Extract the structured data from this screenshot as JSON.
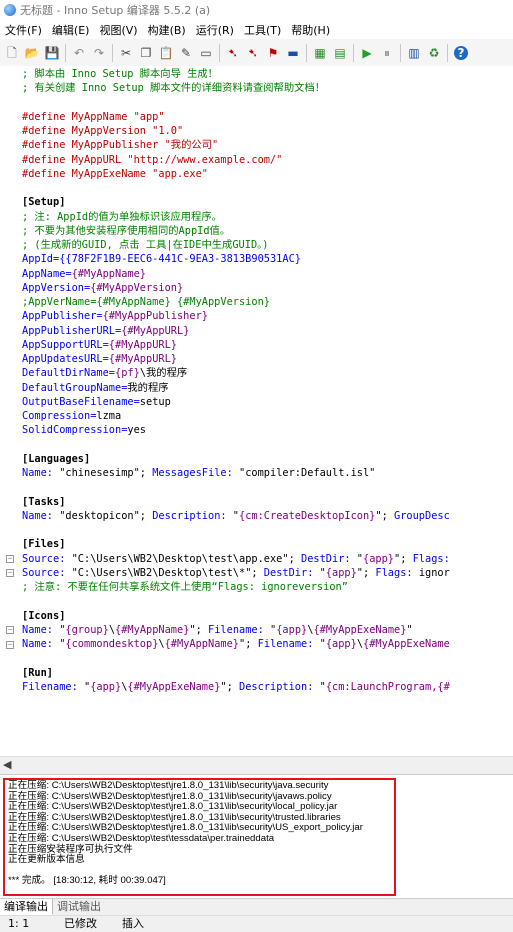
{
  "window": {
    "title": "无标题 - Inno Setup 编译器 5.5.2 (a)"
  },
  "menu": [
    "文件(F)",
    "编辑(E)",
    "视图(V)",
    "构建(B)",
    "运行(R)",
    "工具(T)",
    "帮助(H)"
  ],
  "toolbar": [
    {
      "name": "new-file-icon",
      "glyph": "🗋",
      "color": "#555"
    },
    {
      "name": "open-folder-icon",
      "glyph": "📂",
      "color": "#c9a000"
    },
    {
      "name": "save-icon",
      "glyph": "💾",
      "color": "#1b4fa8"
    },
    {
      "sep": true
    },
    {
      "name": "undo-icon",
      "glyph": "↶",
      "color": "#888"
    },
    {
      "name": "redo-icon",
      "glyph": "↷",
      "color": "#888"
    },
    {
      "sep": true
    },
    {
      "name": "cut-icon",
      "glyph": "✂",
      "color": "#444"
    },
    {
      "name": "copy-icon",
      "glyph": "❐",
      "color": "#444"
    },
    {
      "name": "paste-icon",
      "glyph": "📋",
      "color": "#444"
    },
    {
      "name": "edit-icon",
      "glyph": "✎",
      "color": "#444"
    },
    {
      "name": "file-icon",
      "glyph": "▭",
      "color": "#444"
    },
    {
      "sep": true
    },
    {
      "name": "compile-icon",
      "glyph": "➷",
      "color": "#c00000"
    },
    {
      "name": "compile-selection-icon",
      "glyph": "➷",
      "color": "#c00000"
    },
    {
      "name": "find-icon",
      "glyph": "⚑",
      "color": "#c00000"
    },
    {
      "name": "replace-icon",
      "glyph": "▬",
      "color": "#1b4fa8"
    },
    {
      "sep": true
    },
    {
      "name": "build-icon",
      "glyph": "▦",
      "color": "#2a8a2a"
    },
    {
      "name": "stop-build-icon",
      "glyph": "▤",
      "color": "#2a8a2a"
    },
    {
      "sep": true
    },
    {
      "name": "run-icon",
      "glyph": "▶",
      "color": "#22a022"
    },
    {
      "name": "pause-icon",
      "glyph": "⏸",
      "color": "#888"
    },
    {
      "sep": true
    },
    {
      "name": "wizard-icon",
      "glyph": "▥",
      "color": "#1b4fa8"
    },
    {
      "name": "settings-icon",
      "glyph": "♻",
      "color": "#2a8a2a"
    },
    {
      "sep": true
    },
    {
      "name": "help-icon",
      "glyph": "?",
      "color": "#fff",
      "bg": "#1b6ac9"
    }
  ],
  "editor": {
    "lines": [
      {
        "fold": false,
        "t": [
          [
            "com",
            "; 脚本由 Inno Setup 脚本向导 生成！"
          ]
        ]
      },
      {
        "fold": false,
        "t": [
          [
            "com",
            "; 有关创建 Inno Setup 脚本文件的详细资料请查阅帮助文档！"
          ]
        ]
      },
      {
        "fold": false,
        "t": []
      },
      {
        "fold": false,
        "t": [
          [
            "dir",
            "#define MyAppName \"app\""
          ]
        ]
      },
      {
        "fold": false,
        "t": [
          [
            "dir",
            "#define MyAppVersion \"1.0\""
          ]
        ]
      },
      {
        "fold": false,
        "t": [
          [
            "dir",
            "#define MyAppPublisher \"我的公司\""
          ]
        ]
      },
      {
        "fold": false,
        "t": [
          [
            "dir",
            "#define MyAppURL \"http://www.example.com/\""
          ]
        ]
      },
      {
        "fold": false,
        "t": [
          [
            "dir",
            "#define MyAppExeName \"app.exe\""
          ]
        ]
      },
      {
        "fold": false,
        "t": []
      },
      {
        "fold": false,
        "t": [
          [
            "sec",
            "[Setup]"
          ]
        ]
      },
      {
        "fold": false,
        "t": [
          [
            "com",
            "; 注: AppId的值为单独标识该应用程序。"
          ]
        ]
      },
      {
        "fold": false,
        "t": [
          [
            "com",
            "; 不要为其他安装程序使用相同的AppId值。"
          ]
        ]
      },
      {
        "fold": false,
        "t": [
          [
            "com",
            "; (生成新的GUID, 点击 工具|在IDE中生成GUID。)"
          ]
        ]
      },
      {
        "fold": false,
        "t": [
          [
            "key",
            "AppId={{78F2F1B9-EEC6-441C-9EA3-3813B90531AC}"
          ]
        ]
      },
      {
        "fold": false,
        "t": [
          [
            "key",
            "AppName="
          ],
          [
            "const",
            "{#MyAppName}"
          ]
        ]
      },
      {
        "fold": false,
        "t": [
          [
            "key",
            "AppVersion="
          ],
          [
            "const",
            "{#MyAppVersion}"
          ]
        ]
      },
      {
        "fold": false,
        "t": [
          [
            "com",
            ";AppVerName={#MyAppName} {#MyAppVersion}"
          ]
        ]
      },
      {
        "fold": false,
        "t": [
          [
            "key",
            "AppPublisher="
          ],
          [
            "const",
            "{#MyAppPublisher}"
          ]
        ]
      },
      {
        "fold": false,
        "t": [
          [
            "key",
            "AppPublisherURL="
          ],
          [
            "const",
            "{#MyAppURL}"
          ]
        ]
      },
      {
        "fold": false,
        "t": [
          [
            "key",
            "AppSupportURL="
          ],
          [
            "const",
            "{#MyAppURL}"
          ]
        ]
      },
      {
        "fold": false,
        "t": [
          [
            "key",
            "AppUpdatesURL="
          ],
          [
            "const",
            "{#MyAppURL}"
          ]
        ]
      },
      {
        "fold": false,
        "t": [
          [
            "key",
            "DefaultDirName="
          ],
          [
            "const",
            "{pf}"
          ],
          [
            "plain",
            "\\我的程序"
          ]
        ]
      },
      {
        "fold": false,
        "t": [
          [
            "key",
            "DefaultGroupName="
          ],
          [
            "plain",
            "我的程序"
          ]
        ]
      },
      {
        "fold": false,
        "t": [
          [
            "key",
            "OutputBaseFilename="
          ],
          [
            "plain",
            "setup"
          ]
        ]
      },
      {
        "fold": false,
        "t": [
          [
            "key",
            "Compression="
          ],
          [
            "plain",
            "lzma"
          ]
        ]
      },
      {
        "fold": false,
        "t": [
          [
            "key",
            "SolidCompression="
          ],
          [
            "plain",
            "yes"
          ]
        ]
      },
      {
        "fold": false,
        "t": []
      },
      {
        "fold": false,
        "t": [
          [
            "sec",
            "[Languages]"
          ]
        ]
      },
      {
        "fold": false,
        "t": [
          [
            "key",
            "Name: "
          ],
          [
            "str",
            "\"chinesesimp\""
          ],
          [
            "plain",
            "; "
          ],
          [
            "key",
            "MessagesFile: "
          ],
          [
            "str",
            "\"compiler:Default.isl\""
          ]
        ]
      },
      {
        "fold": false,
        "t": []
      },
      {
        "fold": false,
        "t": [
          [
            "sec",
            "[Tasks]"
          ]
        ]
      },
      {
        "fold": false,
        "t": [
          [
            "key",
            "Name: "
          ],
          [
            "str",
            "\"desktopicon\""
          ],
          [
            "plain",
            "; "
          ],
          [
            "key",
            "Description: "
          ],
          [
            "str",
            "\""
          ],
          [
            "const",
            "{cm:CreateDesktopIcon}"
          ],
          [
            "str",
            "\""
          ],
          [
            "plain",
            "; "
          ],
          [
            "key",
            "GroupDesc"
          ]
        ]
      },
      {
        "fold": false,
        "t": []
      },
      {
        "fold": false,
        "t": [
          [
            "sec",
            "[Files]"
          ]
        ]
      },
      {
        "fold": true,
        "t": [
          [
            "key",
            "Source: "
          ],
          [
            "str",
            "\"C:\\Users\\WB2\\Desktop\\test\\app.exe\""
          ],
          [
            "plain",
            "; "
          ],
          [
            "key",
            "DestDir: "
          ],
          [
            "str",
            "\""
          ],
          [
            "const",
            "{app}"
          ],
          [
            "str",
            "\""
          ],
          [
            "plain",
            "; "
          ],
          [
            "key",
            "Flags:"
          ]
        ]
      },
      {
        "fold": true,
        "t": [
          [
            "key",
            "Source: "
          ],
          [
            "str",
            "\"C:\\Users\\WB2\\Desktop\\test\\*\""
          ],
          [
            "plain",
            "; "
          ],
          [
            "key",
            "DestDir: "
          ],
          [
            "str",
            "\""
          ],
          [
            "const",
            "{app}"
          ],
          [
            "str",
            "\""
          ],
          [
            "plain",
            "; "
          ],
          [
            "key",
            "Flags: "
          ],
          [
            "plain",
            "ignor"
          ]
        ]
      },
      {
        "fold": false,
        "t": [
          [
            "com",
            "; 注意: 不要在任何共享系统文件上使用“Flags: ignoreversion”"
          ]
        ]
      },
      {
        "fold": false,
        "t": []
      },
      {
        "fold": false,
        "t": [
          [
            "sec",
            "[Icons]"
          ]
        ]
      },
      {
        "fold": true,
        "t": [
          [
            "key",
            "Name: "
          ],
          [
            "str",
            "\""
          ],
          [
            "const",
            "{group}"
          ],
          [
            "str",
            "\\"
          ],
          [
            "const",
            "{#MyAppName}"
          ],
          [
            "str",
            "\""
          ],
          [
            "plain",
            "; "
          ],
          [
            "key",
            "Filename: "
          ],
          [
            "str",
            "\""
          ],
          [
            "const",
            "{app}"
          ],
          [
            "str",
            "\\"
          ],
          [
            "const",
            "{#MyAppExeName}"
          ],
          [
            "str",
            "\""
          ]
        ]
      },
      {
        "fold": true,
        "t": [
          [
            "key",
            "Name: "
          ],
          [
            "str",
            "\""
          ],
          [
            "const",
            "{commondesktop}"
          ],
          [
            "str",
            "\\"
          ],
          [
            "const",
            "{#MyAppName}"
          ],
          [
            "str",
            "\""
          ],
          [
            "plain",
            "; "
          ],
          [
            "key",
            "Filename: "
          ],
          [
            "str",
            "\""
          ],
          [
            "const",
            "{app}"
          ],
          [
            "str",
            "\\"
          ],
          [
            "const",
            "{#MyAppExeName"
          ]
        ]
      },
      {
        "fold": false,
        "t": []
      },
      {
        "fold": false,
        "t": [
          [
            "sec",
            "[Run]"
          ]
        ]
      },
      {
        "fold": false,
        "t": [
          [
            "key",
            "Filename: "
          ],
          [
            "str",
            "\""
          ],
          [
            "const",
            "{app}"
          ],
          [
            "str",
            "\\"
          ],
          [
            "const",
            "{#MyAppExeName}"
          ],
          [
            "str",
            "\""
          ],
          [
            "plain",
            "; "
          ],
          [
            "key",
            "Description: "
          ],
          [
            "str",
            "\""
          ],
          [
            "const",
            "{cm:LaunchProgram,{#"
          ]
        ]
      }
    ]
  },
  "output": {
    "lines": [
      "正在压缩: C:\\Users\\WB2\\Desktop\\test\\jre1.8.0_131\\lib\\security\\java.security",
      "正在压缩: C:\\Users\\WB2\\Desktop\\test\\jre1.8.0_131\\lib\\security\\javaws.policy",
      "正在压缩: C:\\Users\\WB2\\Desktop\\test\\jre1.8.0_131\\lib\\security\\local_policy.jar",
      "正在压缩: C:\\Users\\WB2\\Desktop\\test\\jre1.8.0_131\\lib\\security\\trusted.libraries",
      "正在压缩: C:\\Users\\WB2\\Desktop\\test\\jre1.8.0_131\\lib\\security\\US_export_policy.jar",
      "正在压缩: C:\\Users\\WB2\\Desktop\\test\\tessdata\\per.traineddata",
      "正在压缩安装程序可执行文件",
      "正在更新版本信息",
      "",
      "*** 完成。 [18:30:12, 耗时 00:39.047]"
    ]
  },
  "tabs": {
    "compile_output": "编译输出",
    "debug_output": "调试输出"
  },
  "status": {
    "position": "1:  1",
    "modified": "已修改",
    "insert": "插入"
  }
}
